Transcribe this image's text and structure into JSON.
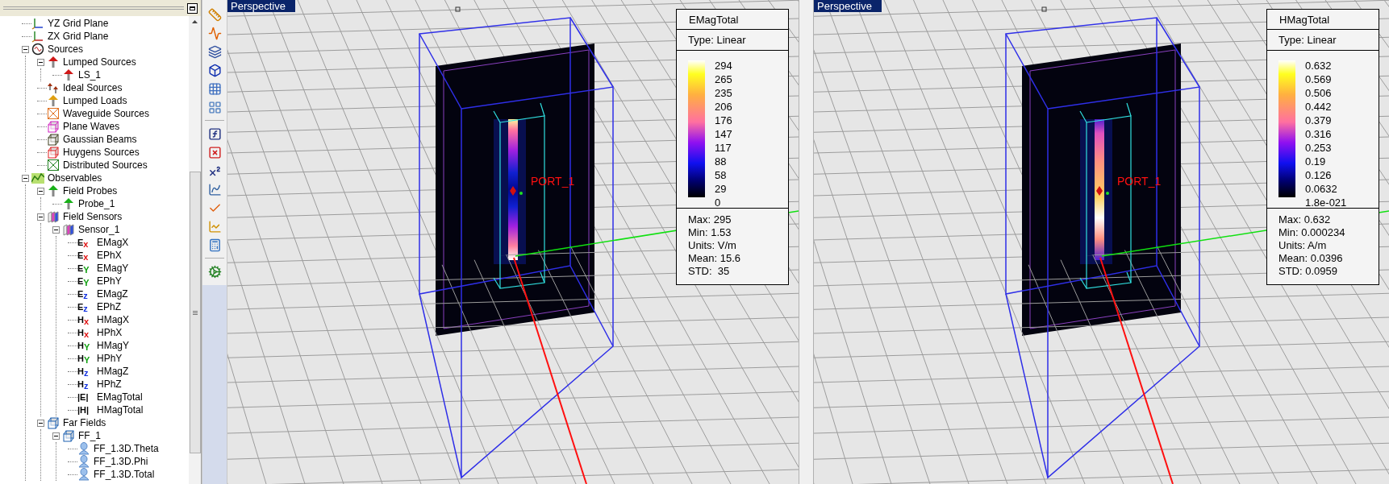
{
  "tree": [
    {
      "label": "YZ Grid Plane",
      "kind": "axes-yz"
    },
    {
      "label": "ZX Grid Plane",
      "kind": "axes-zx"
    },
    {
      "label": "Sources",
      "kind": "source",
      "expanded": true,
      "children": [
        {
          "label": "Lumped Sources",
          "kind": "port-red",
          "expanded": true,
          "children": [
            {
              "label": "LS_1",
              "kind": "port-red"
            }
          ]
        },
        {
          "label": "Ideal Sources",
          "kind": "port-small"
        },
        {
          "label": "Lumped Loads",
          "kind": "port-yellow"
        },
        {
          "label": "Waveguide Sources",
          "kind": "waveguide"
        },
        {
          "label": "Plane Waves",
          "kind": "plane-wave"
        },
        {
          "label": "Gaussian Beams",
          "kind": "gaussian"
        },
        {
          "label": "Huygens Sources",
          "kind": "huygens"
        },
        {
          "label": "Distributed Sources",
          "kind": "distributed"
        }
      ]
    },
    {
      "label": "Observables",
      "kind": "observables",
      "expanded": true,
      "children": [
        {
          "label": "Field Probes",
          "kind": "probe",
          "expanded": true,
          "children": [
            {
              "label": "Probe_1",
              "kind": "probe"
            }
          ]
        },
        {
          "label": "Field Sensors",
          "kind": "sensor",
          "expanded": true,
          "children": [
            {
              "label": "Sensor_1",
              "kind": "sensor",
              "expanded": true,
              "children": [
                {
                  "label": "EMagX",
                  "symbol": "E",
                  "subscript": "x",
                  "color": "#e01010"
                },
                {
                  "label": "EPhX",
                  "symbol": "E",
                  "subscript": "x",
                  "color": "#e01010"
                },
                {
                  "label": "EMagY",
                  "symbol": "E",
                  "subscript": "Y",
                  "color": "#10a010"
                },
                {
                  "label": "EPhY",
                  "symbol": "E",
                  "subscript": "Y",
                  "color": "#10a010"
                },
                {
                  "label": "EMagZ",
                  "symbol": "E",
                  "subscript": "z",
                  "color": "#1030e0"
                },
                {
                  "label": "EPhZ",
                  "symbol": "E",
                  "subscript": "z",
                  "color": "#1030e0"
                },
                {
                  "label": "HMagX",
                  "symbol": "H",
                  "subscript": "x",
                  "color": "#e01010"
                },
                {
                  "label": "HPhX",
                  "symbol": "H",
                  "subscript": "x",
                  "color": "#e01010"
                },
                {
                  "label": "HMagY",
                  "symbol": "H",
                  "subscript": "Y",
                  "color": "#10a010"
                },
                {
                  "label": "HPhY",
                  "symbol": "H",
                  "subscript": "Y",
                  "color": "#10a010"
                },
                {
                  "label": "HMagZ",
                  "symbol": "H",
                  "subscript": "z",
                  "color": "#1030e0"
                },
                {
                  "label": "HPhZ",
                  "symbol": "H",
                  "subscript": "z",
                  "color": "#1030e0"
                },
                {
                  "label": "EMagTotal",
                  "symbol": "|E|"
                },
                {
                  "label": "HMagTotal",
                  "symbol": "|H|"
                }
              ]
            }
          ]
        },
        {
          "label": "Far Fields",
          "kind": "far-field",
          "expanded": true,
          "children": [
            {
              "label": "FF_1",
              "kind": "far-field",
              "expanded": true,
              "children": [
                {
                  "label": "FF_1.3D.Theta",
                  "kind": "pattern"
                },
                {
                  "label": "FF_1.3D.Phi",
                  "kind": "pattern"
                },
                {
                  "label": "FF_1.3D.Total",
                  "kind": "pattern"
                }
              ]
            }
          ]
        }
      ]
    }
  ],
  "toolbar": [
    {
      "kind": "ruler"
    },
    {
      "kind": "wave"
    },
    {
      "kind": "layers"
    },
    {
      "kind": "box"
    },
    {
      "kind": "grid"
    },
    {
      "kind": "gridsplit"
    },
    {
      "kind": "separator"
    },
    {
      "kind": "function"
    },
    {
      "kind": "xmark"
    },
    {
      "kind": "superscript"
    },
    {
      "kind": "chart"
    },
    {
      "kind": "check"
    },
    {
      "kind": "curve"
    },
    {
      "kind": "calculator"
    },
    {
      "kind": "separator"
    },
    {
      "kind": "gear"
    }
  ],
  "viewports": [
    {
      "label": "Perspective",
      "port_label": "PORT_1",
      "kind": "split",
      "legend": {
        "title": "EMagTotal",
        "type": "Type: Linear",
        "ticks": [
          "294",
          "265",
          "235",
          "206",
          "176",
          "147",
          "117",
          "88",
          "58",
          "29",
          "0"
        ],
        "stats": [
          "Max: 295",
          "Min: 1.53",
          "Units: V/m",
          "Mean: 15.6",
          "STD:  35"
        ]
      }
    },
    {
      "label": "Perspective",
      "port_label": "PORT_1",
      "kind": "solid",
      "legend": {
        "title": "HMagTotal",
        "type": "Type: Linear",
        "ticks": [
          "0.632",
          "0.569",
          "0.506",
          "0.442",
          "0.379",
          "0.316",
          "0.253",
          "0.19",
          "0.126",
          "0.0632",
          "1.8e-021"
        ],
        "stats": [
          "Max: 0.632",
          "Min: 0.000234",
          "Units: A/m",
          "Mean: 0.0396",
          "STD: 0.0959"
        ]
      }
    }
  ]
}
